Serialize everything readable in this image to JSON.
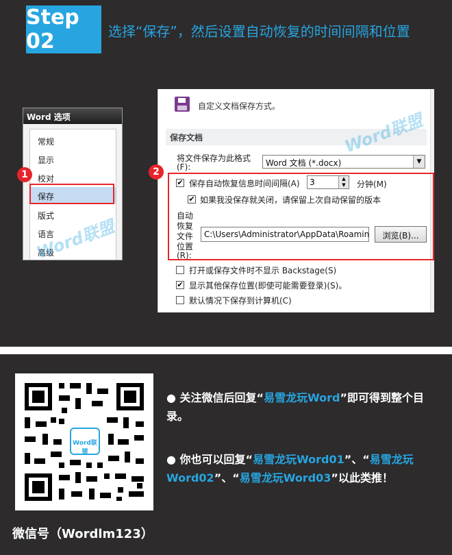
{
  "step": {
    "badge": "Step 02",
    "title": "选择“保存”，然后设置自动恢复的时间间隔和位置"
  },
  "options": {
    "title": "Word 选项",
    "items": [
      "常规",
      "显示",
      "校对",
      "保存",
      "版式",
      "语言",
      "高级"
    ],
    "selected": "保存"
  },
  "markers": [
    "1",
    "2"
  ],
  "save": {
    "header": "自定义文档保存方式。",
    "section": "保存文档",
    "format_label_1": "将文件保存为此格式",
    "format_label_2": "(F):",
    "format_value": "Word 文档 (*.docx)",
    "autosave_label": "保存自动恢复信息时间间隔(A)",
    "autosave_minutes": "3",
    "minutes_unit": "分钟(M)",
    "keep_last_label": "如果我没保存就关闭，请保留上次自动保留的版本",
    "location_label": [
      "自动",
      "恢复",
      "文件",
      "位置",
      "(R):"
    ],
    "location_value": "C:\\Users\\Administrator\\AppData\\Roaming",
    "browse_label": "浏览(B)...",
    "backstage_label": "打开或保存文件时不显示 Backstage(S)",
    "show_places_label": "显示其他保存位置(即使可能需要登录)(S)。",
    "save_local_label": "默认情况下保存到计算机(C)"
  },
  "watermark": {
    "text1": "Word",
    "text2": "联盟"
  },
  "bottom": {
    "wechat_id": "微信号（Wordlm123）",
    "bullet1": {
      "pre": "关注微信后回复“",
      "highlight": "易雪龙玩Word",
      "post": "”即可得到整个目录。"
    },
    "bullet2": {
      "pre": "你也可以回复“",
      "h1": "易雪龙玩Word01",
      "mid1": "”、“",
      "h2": "易雪龙玩Word02",
      "mid2": "”、“",
      "h3": "易雪龙玩Word03",
      "post": "”以此类推！"
    },
    "qr_logo": "Word联盟"
  },
  "colors": {
    "accent": "#27a5e0",
    "marker": "#e8242b",
    "panel": "#2d2b2c"
  }
}
